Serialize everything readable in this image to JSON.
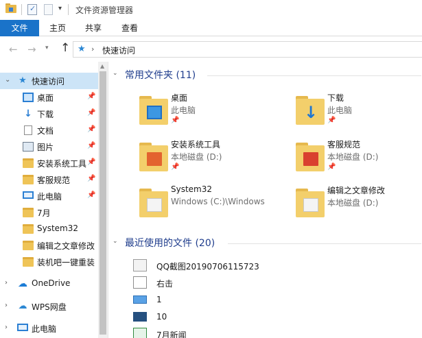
{
  "window": {
    "title": "文件资源管理器"
  },
  "ribbon": {
    "tabs": [
      "文件",
      "主页",
      "共享",
      "查看"
    ]
  },
  "address": {
    "path": "快速访问"
  },
  "nav_pane": {
    "quick_access": "快速访问",
    "items": [
      {
        "label": "桌面",
        "icon": "desktop-icon",
        "pinned": true
      },
      {
        "label": "下载",
        "icon": "download-icon",
        "pinned": true
      },
      {
        "label": "文档",
        "icon": "document-icon",
        "pinned": true
      },
      {
        "label": "图片",
        "icon": "picture-icon",
        "pinned": true
      },
      {
        "label": "安装系统工具",
        "icon": "folder-icon",
        "pinned": true
      },
      {
        "label": "客服规范",
        "icon": "folder-icon",
        "pinned": true
      },
      {
        "label": "此电脑",
        "icon": "computer-icon",
        "pinned": true
      },
      {
        "label": "7月",
        "icon": "folder-icon",
        "pinned": false
      },
      {
        "label": "System32",
        "icon": "folder-icon",
        "pinned": false
      },
      {
        "label": "编辑之文章修改",
        "icon": "folder-icon",
        "pinned": false
      },
      {
        "label": "装机吧一键重装",
        "icon": "folder-icon",
        "pinned": false
      }
    ],
    "onedrive": "OneDrive",
    "wps": "WPS网盘",
    "this_pc": "此电脑"
  },
  "frequent": {
    "header": "常用文件夹 (11)",
    "tiles": [
      {
        "name": "桌面",
        "sub": "此电脑",
        "pinned": true
      },
      {
        "name": "下载",
        "sub": "此电脑",
        "pinned": true
      },
      {
        "name": "安装系统工具",
        "sub": "本地磁盘 (D:)",
        "pinned": true
      },
      {
        "name": "客服规范",
        "sub": "本地磁盘 (D:)",
        "pinned": true
      },
      {
        "name": "System32",
        "sub": "Windows (C:)\\Windows",
        "pinned": false
      },
      {
        "name": "编辑之文章修改",
        "sub": "本地磁盘 (D:)",
        "pinned": false
      }
    ]
  },
  "recent": {
    "header": "最近使用的文件 (20)",
    "files": [
      "QQ截图20190706115723",
      "右击",
      "1",
      "10",
      "7月新闻"
    ]
  },
  "colors": {
    "accent": "#1a73c9",
    "header_text": "#1e3c8c",
    "selection": "#cce4f7",
    "folder": "#f3cf6b"
  }
}
